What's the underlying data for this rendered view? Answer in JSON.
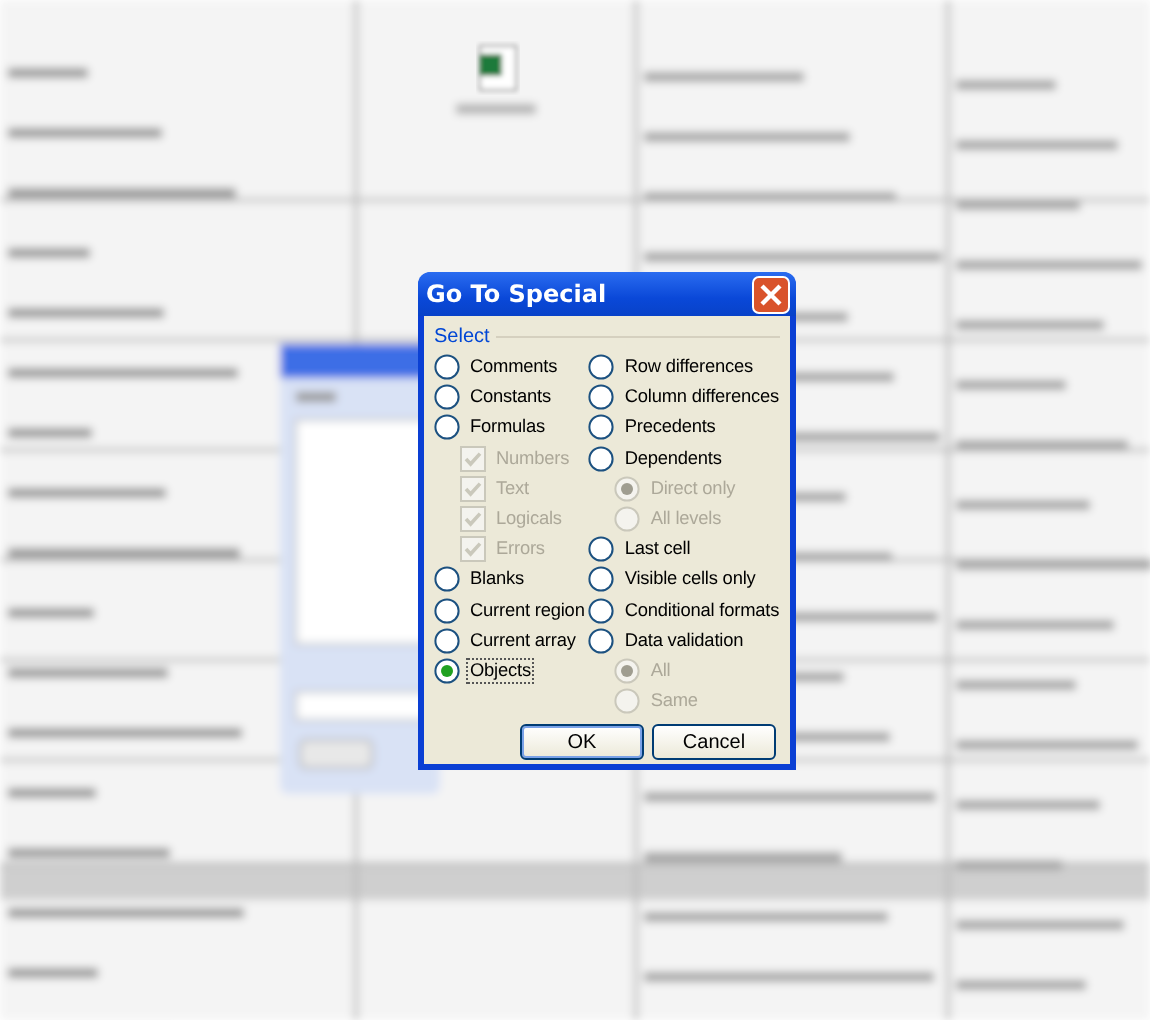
{
  "dialog": {
    "title": "Go To Special",
    "group_label": "Select",
    "columns": [
      [
        {
          "kind": "radio",
          "label": "Comments",
          "selected": false,
          "disabled": false
        },
        {
          "kind": "radio",
          "label": "Constants",
          "selected": false,
          "disabled": false
        },
        {
          "kind": "radio",
          "label": "Formulas",
          "selected": false,
          "disabled": false,
          "children": [
            {
              "kind": "checkbox",
              "label": "Numbers",
              "checked": true,
              "disabled": true
            },
            {
              "kind": "checkbox",
              "label": "Text",
              "checked": true,
              "disabled": true
            },
            {
              "kind": "checkbox",
              "label": "Logicals",
              "checked": true,
              "disabled": true
            },
            {
              "kind": "checkbox",
              "label": "Errors",
              "checked": true,
              "disabled": true
            }
          ]
        },
        {
          "kind": "radio",
          "label": "Blanks",
          "selected": false,
          "disabled": false
        },
        {
          "kind": "radio",
          "label": "Current region",
          "selected": false,
          "disabled": false
        },
        {
          "kind": "radio",
          "label": "Current array",
          "selected": false,
          "disabled": false
        },
        {
          "kind": "radio",
          "label": "Objects",
          "selected": true,
          "disabled": false
        }
      ],
      [
        {
          "kind": "radio",
          "label": "Row differences",
          "selected": false,
          "disabled": false
        },
        {
          "kind": "radio",
          "label": "Column differences",
          "selected": false,
          "disabled": false
        },
        {
          "kind": "radio",
          "label": "Precedents",
          "selected": false,
          "disabled": false
        },
        {
          "kind": "radio",
          "label": "Dependents",
          "selected": false,
          "disabled": false,
          "children": [
            {
              "kind": "radio",
              "label": "Direct only",
              "selected": true,
              "disabled": true
            },
            {
              "kind": "radio",
              "label": "All levels",
              "selected": false,
              "disabled": true
            }
          ]
        },
        {
          "kind": "radio",
          "label": "Last cell",
          "selected": false,
          "disabled": false
        },
        {
          "kind": "radio",
          "label": "Visible cells only",
          "selected": false,
          "disabled": false
        },
        {
          "kind": "radio",
          "label": "Conditional formats",
          "selected": false,
          "disabled": false
        },
        {
          "kind": "radio",
          "label": "Data validation",
          "selected": false,
          "disabled": false,
          "children": [
            {
              "kind": "radio",
              "label": "All",
              "selected": true,
              "disabled": true
            },
            {
              "kind": "radio",
              "label": "Same",
              "selected": false,
              "disabled": true
            }
          ]
        }
      ]
    ],
    "buttons": [
      {
        "label": "OK",
        "default": true
      },
      {
        "label": "Cancel",
        "default": false
      }
    ]
  }
}
